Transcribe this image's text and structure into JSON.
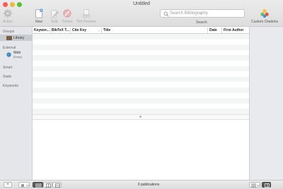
{
  "window": {
    "title": "Untitled"
  },
  "toolbar": {
    "action_label": "Action",
    "new_label": "New",
    "edit_label": "Edit",
    "delete_label": "Delete",
    "tex_preview_label": "TeX Preview",
    "search_placeholder": "Search Bibliography",
    "search_label": "Search",
    "custom_citations_label": "Custom Citations"
  },
  "sidebar": {
    "groups_header": "Groups",
    "library_label": "Library",
    "external_header": "External",
    "web_label": "Web",
    "web_sublabel": "(Empty)",
    "smart_header": "Smart",
    "static_header": "Static",
    "keywords_header": "Keywords"
  },
  "table": {
    "columns": [
      "Keywor...",
      "BibTeX T...",
      "Cite Key",
      "Title",
      "Date",
      "First Author"
    ],
    "sort_indicator": "^"
  },
  "statusbar": {
    "add_label": "+",
    "publication_count": "0 publications"
  },
  "colors": {
    "sidebar_bg": "#e4e6e9",
    "selection": "#c8cbd0",
    "close": "#fc5b57",
    "minimize": "#e5bf3c",
    "maximize": "#57c038"
  },
  "icons": [
    "gear-icon",
    "new-document-icon",
    "edit-icon",
    "delete-icon",
    "tex-preview-icon",
    "search-icon",
    "custom-citations-icon",
    "library-icon",
    "web-globe-icon",
    "gear-menu-icon",
    "list-view-icon",
    "column-view-icon",
    "preview-view-icon",
    "sidebar-toggle-icon"
  ]
}
